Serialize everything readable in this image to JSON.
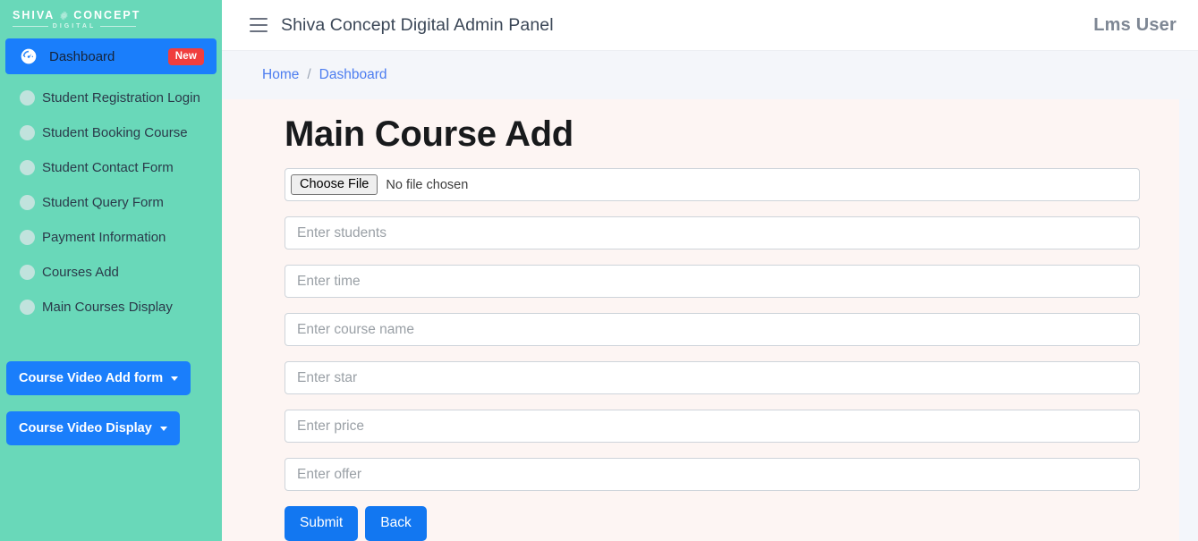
{
  "sidebar": {
    "brand": {
      "word1": "SHIVA",
      "word2": "CONCEPT",
      "sub": "DIGITAL",
      "gear_icon": "gear-icon"
    },
    "active_item": {
      "label": "Dashboard",
      "icon": "gauge-icon",
      "badge": "New"
    },
    "items": [
      {
        "label": "Student Registration Login",
        "icon": "circle-bullet-icon"
      },
      {
        "label": "Student Booking Course",
        "icon": "circle-bullet-icon"
      },
      {
        "label": "Student Contact Form",
        "icon": "circle-bullet-icon"
      },
      {
        "label": "Student Query Form",
        "icon": "circle-bullet-icon"
      },
      {
        "label": "Payment Information",
        "icon": "circle-bullet-icon"
      },
      {
        "label": "Courses Add",
        "icon": "circle-bullet-icon"
      },
      {
        "label": "Main Courses Display",
        "icon": "circle-bullet-icon"
      }
    ],
    "dropdowns": [
      {
        "label": "Course Video Add form",
        "icon": "chevron-down-icon"
      },
      {
        "label": "Course Video Display",
        "icon": "chevron-down-icon"
      }
    ],
    "colors": {
      "background": "#69d8b9",
      "accent": "#1a7efb",
      "badge": "#f03e3e"
    }
  },
  "topbar": {
    "menu_icon": "hamburger-icon",
    "title": "Shiva Concept Digital Admin Panel",
    "user": "Lms User"
  },
  "breadcrumb": {
    "home": "Home",
    "separator": "/",
    "current": "Dashboard"
  },
  "main": {
    "page_title": "Main Course Add",
    "file_input": {
      "button_label": "Choose File",
      "status": "No file chosen"
    },
    "fields": [
      {
        "name": "students",
        "placeholder": "Enter students",
        "value": ""
      },
      {
        "name": "time",
        "placeholder": "Enter time",
        "value": ""
      },
      {
        "name": "course-name",
        "placeholder": "Enter course name",
        "value": ""
      },
      {
        "name": "star",
        "placeholder": "Enter star",
        "value": ""
      },
      {
        "name": "price",
        "placeholder": "Enter price",
        "value": ""
      },
      {
        "name": "offer",
        "placeholder": "Enter offer",
        "value": ""
      }
    ],
    "buttons": {
      "submit": "Submit",
      "back": "Back"
    }
  }
}
